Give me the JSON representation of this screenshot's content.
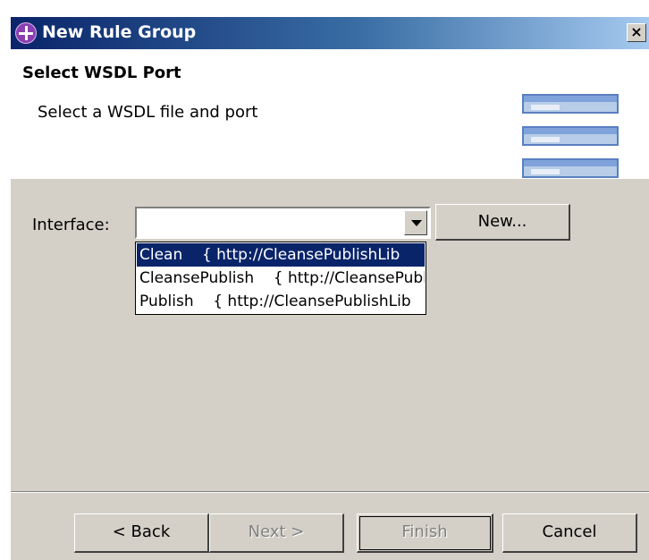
{
  "window": {
    "title": "New Rule Group",
    "close_label": "×"
  },
  "banner": {
    "title": "Select WSDL Port",
    "subtitle": "Select a WSDL file and port"
  },
  "form": {
    "interface_label": "Interface:",
    "interface_value": "",
    "new_button": "New..."
  },
  "dropdown": {
    "items": [
      {
        "label": "Clean    { http://CleansePublishLib",
        "selected": true
      },
      {
        "label": "CleansePublish    { http://CleansePublish",
        "selected": false
      },
      {
        "label": "Publish    { http://CleansePublishLib",
        "selected": false
      }
    ]
  },
  "buttons": {
    "back": "< Back",
    "next": "Next >",
    "finish": "Finish",
    "cancel": "Cancel"
  },
  "colors": {
    "selection": "#0a246a",
    "dialog_face": "#d4d0c8",
    "title_gradient_start": "#0a246a",
    "title_gradient_end": "#a6caf0"
  }
}
